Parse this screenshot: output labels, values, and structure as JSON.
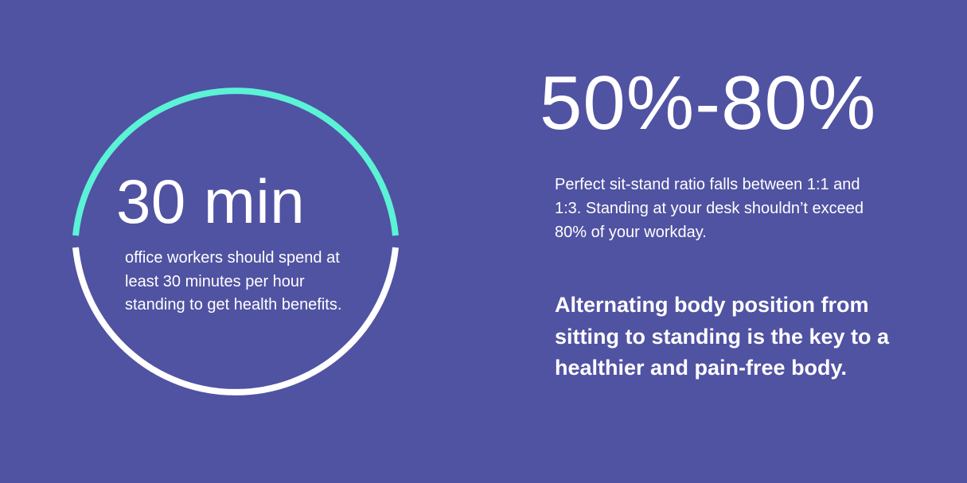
{
  "colors": {
    "background": "#5052a2",
    "ring_top": "#5bf2d6",
    "ring_bottom": "#ffffff",
    "text": "#ffffff"
  },
  "circle_stat": {
    "value": "30 min",
    "description": "office workers should spend at least 30 minutes per hour standing to get health benefits."
  },
  "ratio_stat": {
    "value": "50%-80%",
    "description": "Perfect sit-stand ratio falls between 1:1 and 1:3. Standing at your desk shouldn’t exceed 80% of your workday."
  },
  "key_statement": "Alternating body position from sitting to standing is the key to a healthier and pain-free body."
}
